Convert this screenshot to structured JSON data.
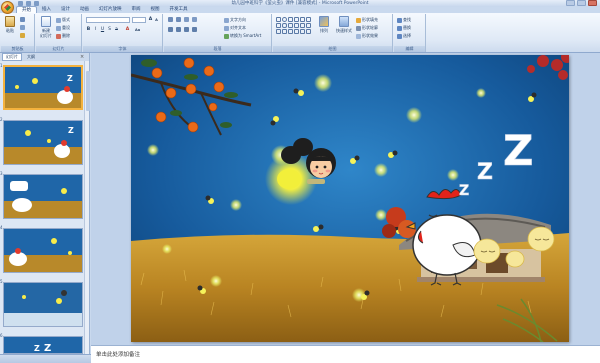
{
  "titlebar": {
    "title": "幼儿园中班科学《萤火虫》课件 [兼容模式] - Microsoft PowerPoint"
  },
  "tabs": [
    "开始",
    "插入",
    "设计",
    "动画",
    "幻灯片放映",
    "审阅",
    "视图",
    "开发工具"
  ],
  "ribbon": {
    "clipboard": {
      "label": "剪贴板",
      "paste": "粘贴"
    },
    "slides": {
      "label": "幻灯片",
      "new_slide": "新建\n幻灯片",
      "layout": "版式",
      "reset": "重设",
      "delete": "删除"
    },
    "font": {
      "label": "字体",
      "font_name": "",
      "font_size": ""
    },
    "paragraph": {
      "label": "段落",
      "text_direction": "文字方向",
      "align_text": "对齐文本",
      "smartart": "转换为 SmartArt"
    },
    "drawing": {
      "label": "绘图",
      "arrange": "排列",
      "quick_styles": "快速样式",
      "shape_fill": "形状填充",
      "shape_outline": "形状轮廓",
      "shape_effects": "形状效果"
    },
    "editing": {
      "label": "编辑",
      "find": "查找",
      "replace": "替换",
      "select": "选择"
    }
  },
  "pane": {
    "tab_slides": "幻灯片",
    "tab_outline": "大纲",
    "close": "×",
    "thumb_numbers": [
      "1",
      "2",
      "3",
      "4",
      "5",
      "6"
    ]
  },
  "notes": {
    "placeholder": "单击此处添加备注"
  },
  "slide": {
    "sleep_letters": [
      "Z",
      "Z",
      "Z"
    ]
  }
}
